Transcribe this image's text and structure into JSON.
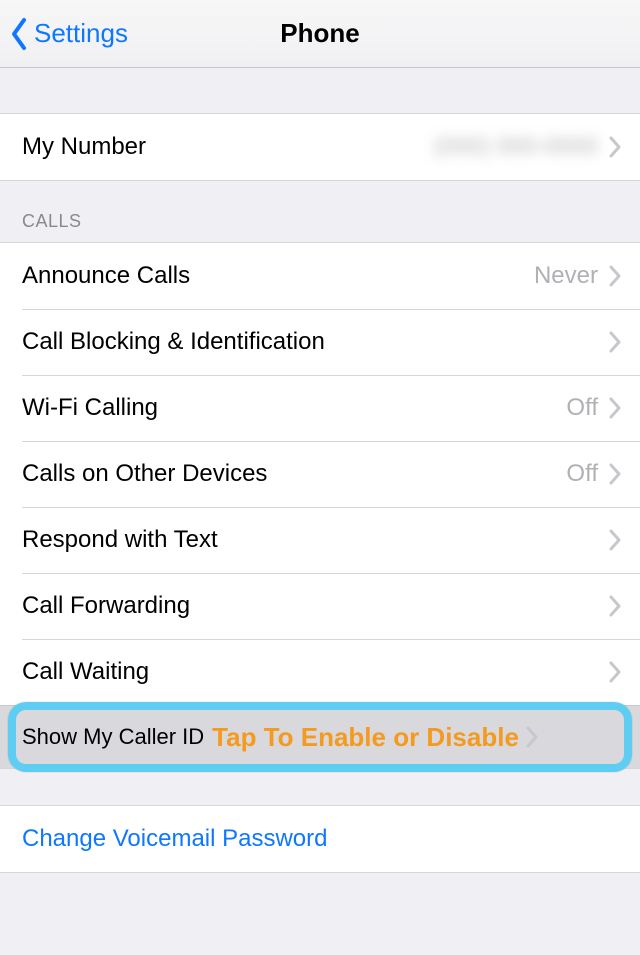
{
  "nav": {
    "back_label": "Settings",
    "title": "Phone"
  },
  "my_number": {
    "label": "My Number",
    "value": "(000) 000-0000"
  },
  "calls_header": "CALLS",
  "calls": [
    {
      "label": "Announce Calls",
      "value": "Never"
    },
    {
      "label": "Call Blocking & Identification",
      "value": ""
    },
    {
      "label": "Wi-Fi Calling",
      "value": "Off"
    },
    {
      "label": "Calls on Other Devices",
      "value": "Off"
    },
    {
      "label": "Respond with Text",
      "value": ""
    },
    {
      "label": "Call Forwarding",
      "value": ""
    },
    {
      "label": "Call Waiting",
      "value": ""
    }
  ],
  "caller_id": {
    "label": "Show My Caller ID",
    "annotation": "Tap To Enable or Disable"
  },
  "voicemail": {
    "label": "Change Voicemail Password"
  }
}
